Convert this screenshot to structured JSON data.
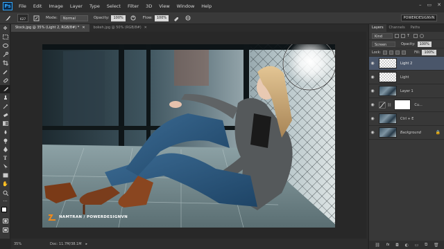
{
  "app": {
    "logo": "Ps"
  },
  "menu": [
    "File",
    "Edit",
    "Image",
    "Layer",
    "Type",
    "Select",
    "Filter",
    "3D",
    "View",
    "Window",
    "Help"
  ],
  "window_controls": [
    "–",
    "▭",
    "✕"
  ],
  "options_bar": {
    "brush_size": "627",
    "mode_label": "Mode:",
    "mode_value": "Normal",
    "opacity_label": "Opacity:",
    "opacity_value": "100%",
    "flow_label": "Flow:",
    "flow_value": "100%",
    "workspace": "POWERDESIGNVN"
  },
  "tabs": [
    {
      "label": "Stock.jpg @ 35% (Light 2, RGB/8#) *",
      "active": true
    },
    {
      "label": "bokeh.jpg @ 50% (RGB/8#)",
      "active": false
    }
  ],
  "canvas": {
    "watermark": "NAMTRAN / POWERDESIGNVN",
    "accent": "#f08a1c"
  },
  "status": {
    "zoom": "35%",
    "doc": "Doc: 11.7M/38.1M"
  },
  "panel": {
    "tabs": [
      "Layers",
      "Channels",
      "Paths"
    ],
    "filter": "Kind",
    "blend_mode": "Screen",
    "opacity_label": "Opacity:",
    "opacity_value": "100%",
    "lock_label": "Lock:",
    "fill_label": "Fill:",
    "fill_value": "100%",
    "layers": [
      {
        "name": "Light 2",
        "thumb": "checker",
        "selected": true
      },
      {
        "name": "Light",
        "thumb": "checker",
        "selected": false
      },
      {
        "name": "Layer 1",
        "thumb": "photo",
        "selected": false
      },
      {
        "name": "Cu...",
        "thumb": "white",
        "selected": false,
        "adjustment": true
      },
      {
        "name": "Ctrl + E",
        "thumb": "photo",
        "selected": false
      },
      {
        "name": "Background",
        "thumb": "photo",
        "selected": false,
        "italic": true
      }
    ],
    "footer_icons": [
      "link-icon",
      "fx-icon",
      "mask-icon",
      "adjustment-icon",
      "folder-icon",
      "new-layer-icon",
      "trash-icon"
    ],
    "fx_label": "fx"
  }
}
